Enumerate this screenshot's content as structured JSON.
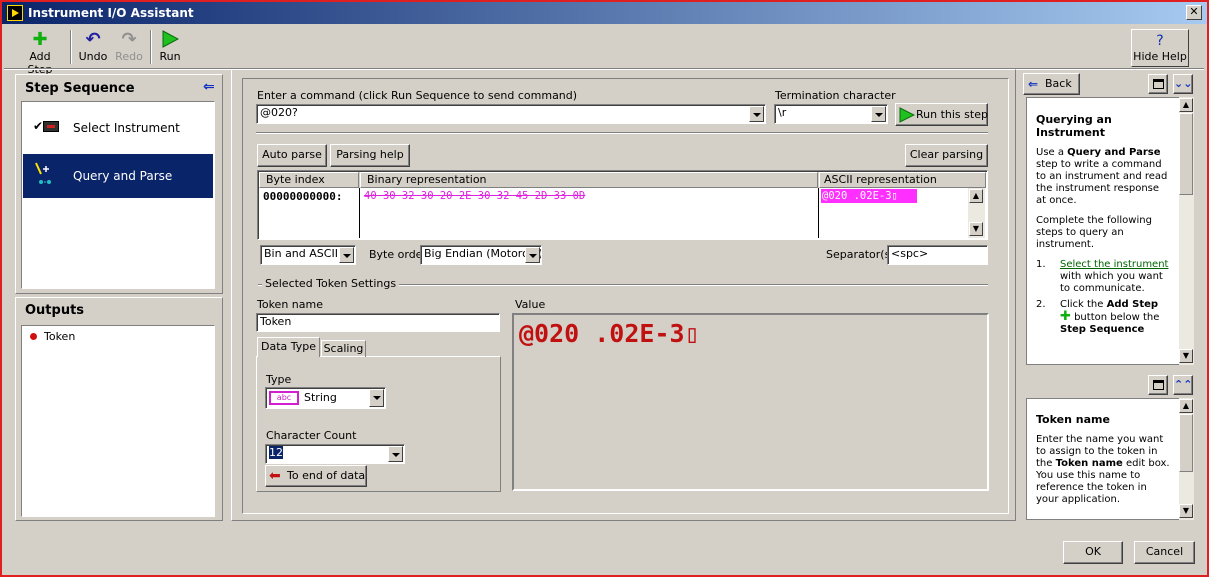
{
  "window": {
    "title": "Instrument I/O Assistant",
    "close": "✕"
  },
  "toolbar": {
    "add_step": "Add Step",
    "undo": "Undo",
    "redo": "Redo",
    "run": "Run",
    "hide_help": "Hide Help"
  },
  "step_sequence": {
    "title": "Step Sequence",
    "items": [
      {
        "label": "Select Instrument"
      },
      {
        "label": "Query and Parse"
      }
    ]
  },
  "outputs": {
    "title": "Outputs",
    "items": [
      {
        "label": "Token"
      }
    ]
  },
  "command": {
    "label": "Enter a command (click Run Sequence to send command)",
    "value": "@020?"
  },
  "termination": {
    "label": "Termination character",
    "value": "\\r"
  },
  "run_step": "Run this step",
  "parse": {
    "auto_parse": "Auto parse",
    "parsing_help": "Parsing help",
    "clear_parsing": "Clear parsing"
  },
  "table": {
    "headers": {
      "byte_index": "Byte index",
      "binary": "Binary representation",
      "ascii": "ASCII representation"
    },
    "row": {
      "byte_index": "00000000000:",
      "binary": "40 30 32 30 20 2E 30 32 45 2D 33 0D",
      "ascii": "@020 .02E-3▯"
    }
  },
  "display_mode": "Bin and ASCII",
  "byte_order": {
    "label": "Byte order",
    "value": "Big Endian (Motorola)"
  },
  "separators": {
    "label": "Separator(s)",
    "value": "<spc>"
  },
  "token_settings": {
    "group_title": "Selected Token Settings",
    "token_name_label": "Token name",
    "token_name_value": "Token",
    "tabs": [
      "Data Type",
      "Scaling"
    ],
    "type_label": "Type",
    "type_icon": "abc",
    "type_value": "String",
    "char_count_label": "Character Count",
    "char_count_value": "12",
    "to_end": "To end of data"
  },
  "value": {
    "label": "Value",
    "text": "@020 .02E-3▯"
  },
  "help": {
    "back": "Back",
    "heading": "Querying an Instrument",
    "p1_a": "Use a ",
    "p1_b": "Query and Parse",
    "p1_c": " step to write a command to an instrument and read the instrument response at once.",
    "p2": "Complete the following steps to query an instrument.",
    "li1_num": "1.",
    "li1_link": "Select the instrument",
    "li1_rest": " with which you want to communicate.",
    "li2_num": "2.",
    "li2_a": "Click the ",
    "li2_b": "Add Step",
    "li2_c": " button below the ",
    "li2_d": "Step Sequence",
    "ctx_heading": "Token name",
    "ctx_a": "Enter the name you want to assign to the token in the ",
    "ctx_b": "Token name",
    "ctx_c": " edit box. You use this name to reference the token in your application."
  },
  "dialog": {
    "ok": "OK",
    "cancel": "Cancel"
  }
}
